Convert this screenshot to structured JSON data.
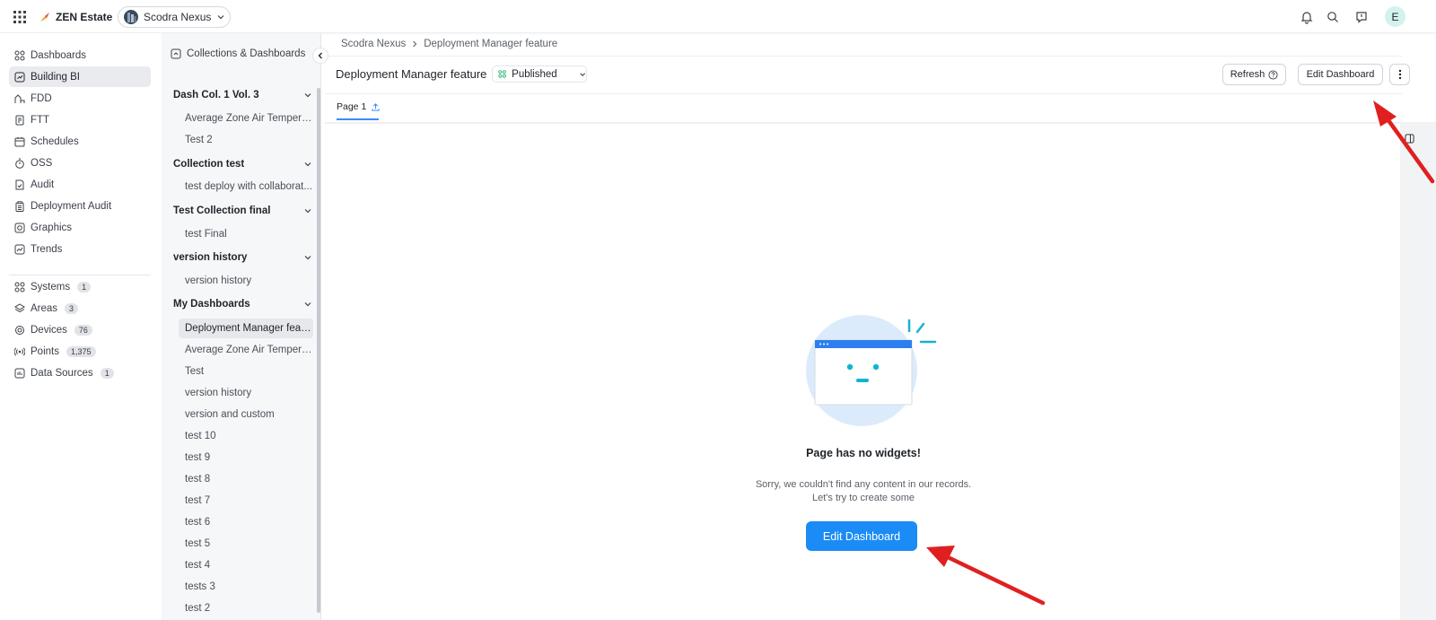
{
  "topbar": {
    "brand_name": "ZEN Estate",
    "site_name": "Scodra Nexus",
    "user_initial": "E",
    "icons": [
      "grid-icon",
      "bell-icon",
      "search-icon",
      "chat-icon"
    ]
  },
  "nav": {
    "primary": [
      {
        "label": "Dashboards",
        "icon": "dashboards-icon"
      },
      {
        "label": "Building BI",
        "icon": "building-bi-icon",
        "active": true
      },
      {
        "label": "FDD",
        "icon": "fdd-icon"
      },
      {
        "label": "FTT",
        "icon": "ftt-icon"
      },
      {
        "label": "Schedules",
        "icon": "calendar-icon"
      },
      {
        "label": "OSS",
        "icon": "timer-icon"
      },
      {
        "label": "Audit",
        "icon": "audit-icon"
      },
      {
        "label": "Deployment Audit",
        "icon": "clipboard-icon"
      },
      {
        "label": "Graphics",
        "icon": "graphics-icon"
      },
      {
        "label": "Trends",
        "icon": "trends-icon"
      }
    ],
    "secondary": [
      {
        "label": "Systems",
        "count": "1",
        "icon": "systems-icon"
      },
      {
        "label": "Areas",
        "count": "3",
        "icon": "layers-icon"
      },
      {
        "label": "Devices",
        "count": "76",
        "icon": "device-icon"
      },
      {
        "label": "Points",
        "count": "1,375",
        "icon": "signal-icon"
      },
      {
        "label": "Data Sources",
        "count": "1",
        "icon": "data-source-icon"
      }
    ]
  },
  "collections": {
    "header": "Collections & Dashboards",
    "groups": [
      {
        "title": "Dash Col. 1 Vol. 3",
        "items": [
          "Average Zone Air Temperat...",
          "Test 2"
        ]
      },
      {
        "title": "Collection test",
        "items": [
          "test deploy with collaborat..."
        ]
      },
      {
        "title": "Test Collection final",
        "items": [
          "test Final"
        ]
      },
      {
        "title": "version history",
        "items": [
          "version history"
        ]
      },
      {
        "title": "My Dashboards",
        "items": [
          "Deployment Manager featu...",
          "Average Zone Air Temperat...",
          "Test",
          "version history",
          "version and custom",
          "test 10",
          "test 9",
          "test 8",
          "test 7",
          "test 6",
          "test 5",
          "test 4",
          "tests 3",
          "test 2"
        ]
      }
    ]
  },
  "main": {
    "breadcrumb": [
      "Scodra Nexus",
      "Deployment Manager feature"
    ],
    "title": "Deployment Manager feature",
    "status": "Published",
    "refresh_label": "Refresh",
    "edit_label": "Edit Dashboard",
    "tab_label": "Page 1",
    "empty": {
      "title": "Page has no widgets!",
      "line1": "Sorry, we couldn't find any content in our records.",
      "line2": "Let's try to create some",
      "button": "Edit Dashboard"
    }
  },
  "colors": {
    "primary": "#1b8cf5",
    "annotation_arrow": "#e02020",
    "published_green": "#22b573",
    "avatar_bg": "#d2f2ee"
  }
}
